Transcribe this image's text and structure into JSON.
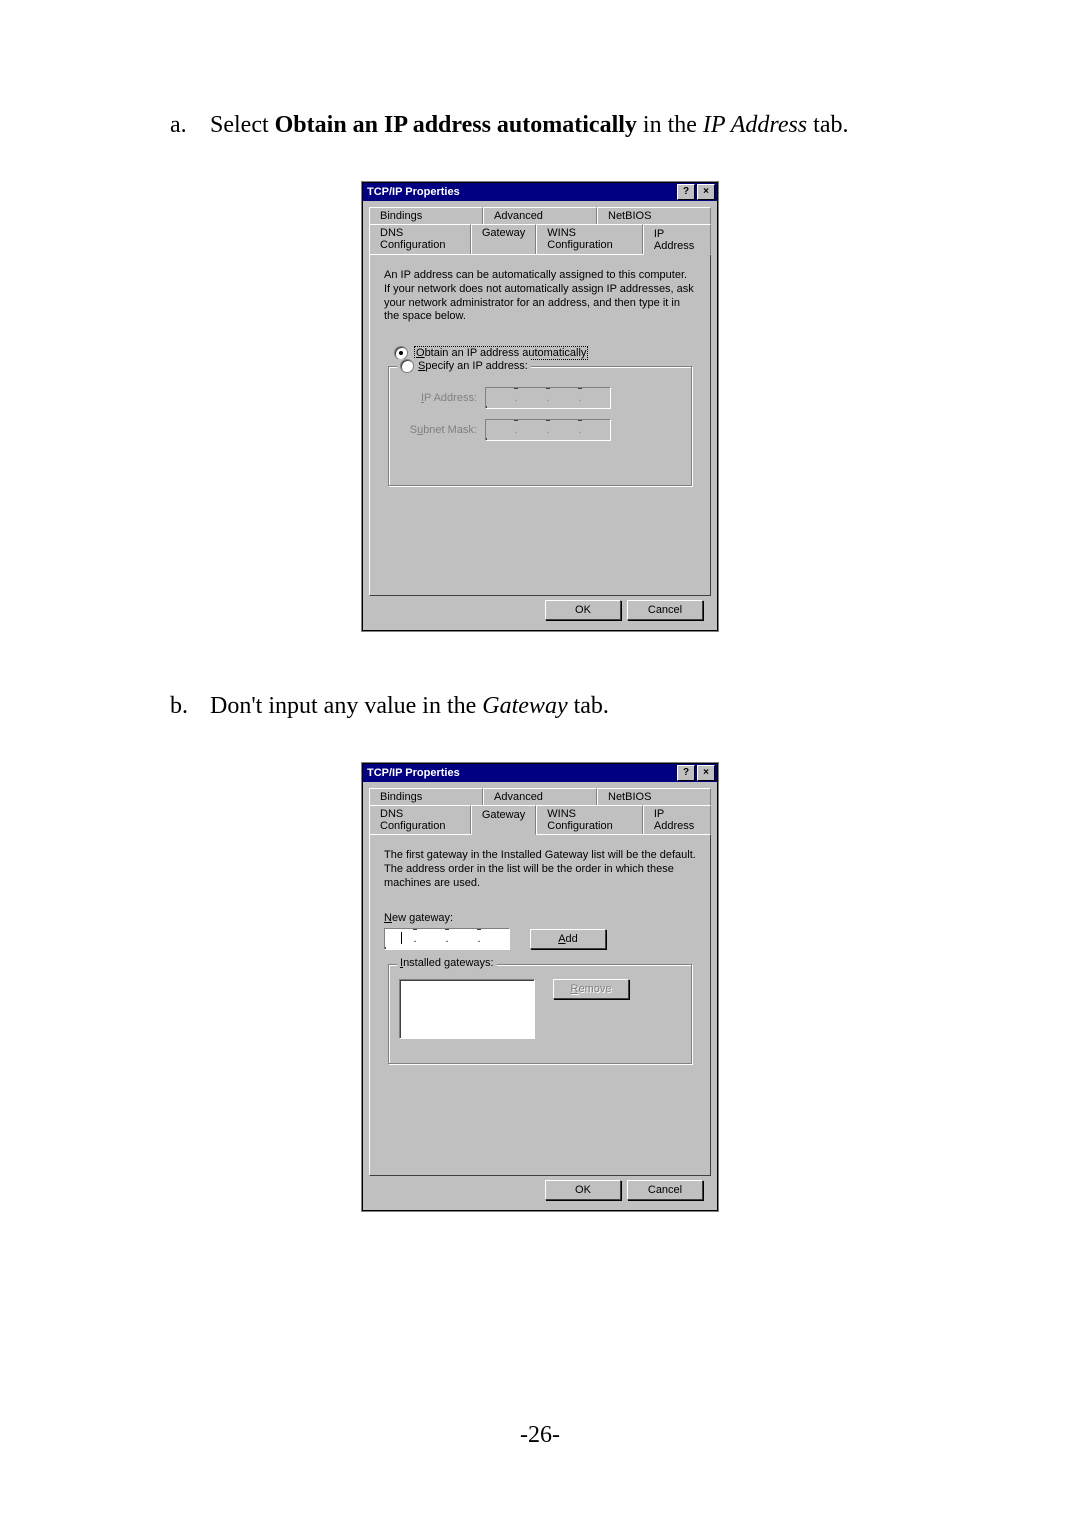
{
  "step_a": {
    "letter": "a.",
    "prefix": "Select ",
    "bold": "Obtain an IP address automatically",
    "mid": " in the ",
    "ital": "IP Address",
    "suffix": " tab."
  },
  "step_b": {
    "letter": "b.",
    "prefix": "Don't input any value in the ",
    "ital": "Gateway",
    "suffix": " tab."
  },
  "dialog1": {
    "title": "TCP/IP Properties",
    "help_glyph": "?",
    "close_glyph": "×",
    "tabs_row1": [
      "Bindings",
      "Advanced",
      "NetBIOS"
    ],
    "tabs_row2": [
      "DNS Configuration",
      "Gateway",
      "WINS Configuration",
      "IP Address"
    ],
    "active_tab": "IP Address",
    "desc": "An IP address can be automatically assigned to this computer. If your network does not automatically assign IP addresses, ask your network administrator for an address, and then type it in the space below.",
    "radio_auto_pre": "O",
    "radio_auto_rest": "btain an IP address automatically",
    "radio_spec_pre": "S",
    "radio_spec_rest": "pecify an IP address:",
    "ip_label_pre": "I",
    "ip_label_rest": "P Address:",
    "mask_label_pre": "S",
    "mask_label_mid": "u",
    "mask_label_rest": "bnet Mask:",
    "dot": ".",
    "ok": "OK",
    "cancel": "Cancel"
  },
  "dialog2": {
    "title": "TCP/IP Properties",
    "help_glyph": "?",
    "close_glyph": "×",
    "tabs_row1": [
      "Bindings",
      "Advanced",
      "NetBIOS"
    ],
    "tabs_row2": [
      "DNS Configuration",
      "Gateway",
      "WINS Configuration",
      "IP Address"
    ],
    "active_tab": "Gateway",
    "desc": "The first gateway in the Installed Gateway list will be the default. The address order in the list will be the order in which these machines are used.",
    "newgw_pre": "N",
    "newgw_rest": "ew gateway:",
    "add_pre": "A",
    "add_rest": "dd",
    "installed_pre": "I",
    "installed_rest": "nstalled gateways:",
    "remove_pre": "R",
    "remove_rest": "emove",
    "dot": ".",
    "ok": "OK",
    "cancel": "Cancel"
  },
  "page_number": "-26-"
}
